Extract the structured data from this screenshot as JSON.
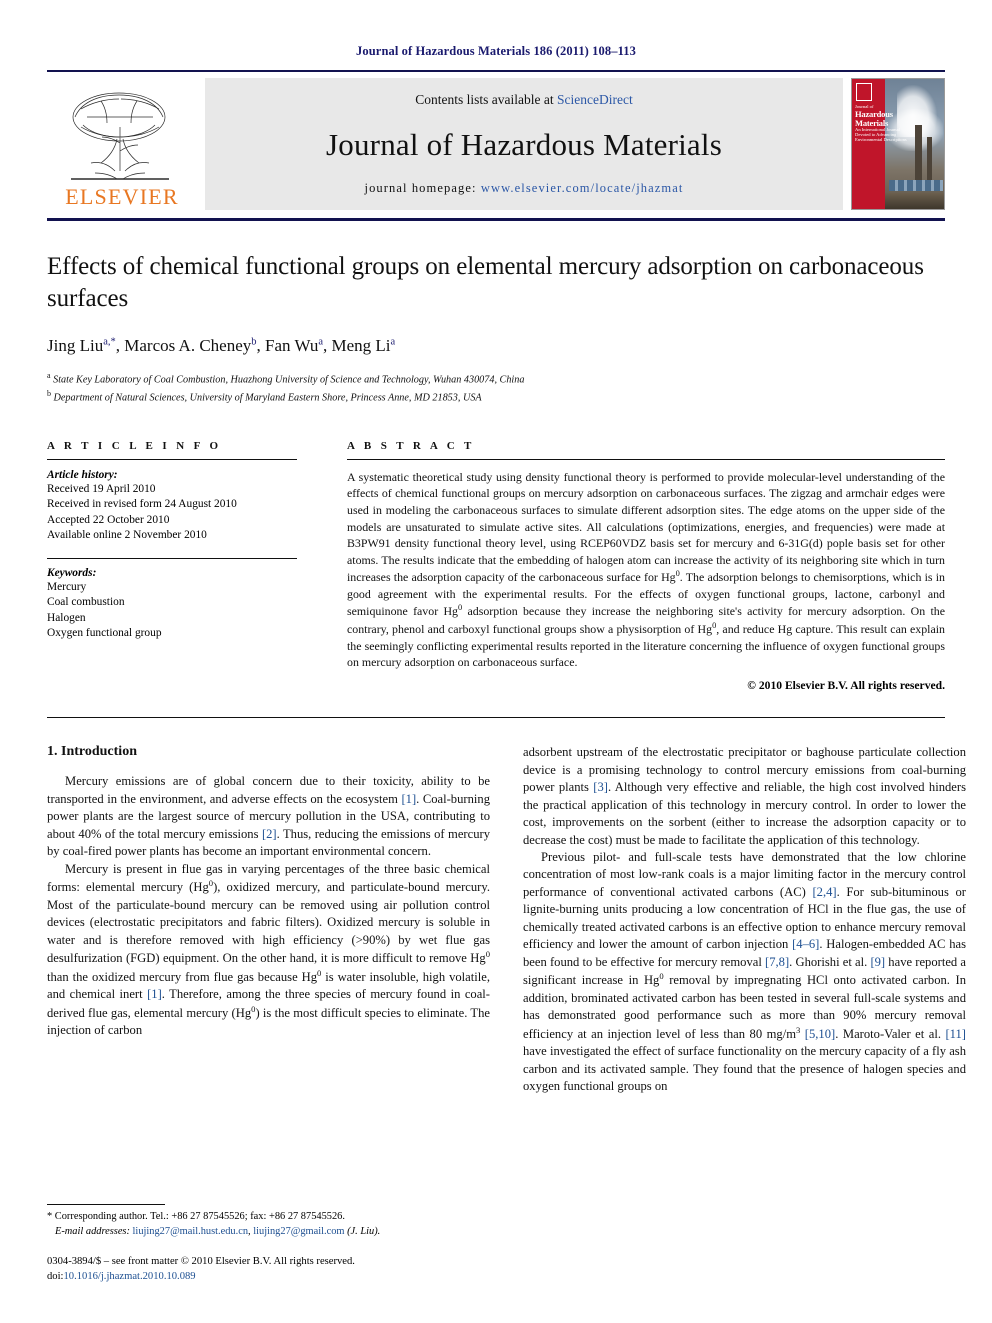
{
  "running_head": "Journal of Hazardous Materials 186 (2011) 108–113",
  "masthead": {
    "publisher": "ELSEVIER",
    "contents_prefix": "Contents lists available at",
    "sciencedirect": "ScienceDirect",
    "journal_name": "Journal of Hazardous Materials",
    "homepage_label": "journal homepage:",
    "homepage_url": "www.elsevier.com/locate/jhazmat",
    "cover": {
      "journal_of": "Journal of",
      "line1": "Hazardous",
      "line2": "Materials",
      "sub1": "An International Journal Devoted to Advancing",
      "sub2": "Environmental Descriptions"
    },
    "colors": {
      "link": "#2b57a6",
      "elsevier_orange": "#E87722",
      "cover_red": "#c0152a",
      "band_gray": "#e8e8e8",
      "rule_navy": "#12124f"
    }
  },
  "title": "Effects of chemical functional groups on elemental mercury adsorption on carbonaceous surfaces",
  "authors_html": "Jing Liu, Marcos A. Cheney, Fan Wu, Meng Li",
  "authors": [
    {
      "name": "Jing Liu",
      "marks": "a,*"
    },
    {
      "name": "Marcos A. Cheney",
      "marks": "b"
    },
    {
      "name": "Fan Wu",
      "marks": "a"
    },
    {
      "name": "Meng Li",
      "marks": "a"
    }
  ],
  "affiliations": [
    {
      "mark": "a",
      "text": "State Key Laboratory of Coal Combustion, Huazhong University of Science and Technology, Wuhan 430074, China"
    },
    {
      "mark": "b",
      "text": "Department of Natural Sciences, University of Maryland Eastern Shore, Princess Anne, MD 21853, USA"
    }
  ],
  "article_info": {
    "heading": "A R T I C L E   I N F O",
    "history_title": "Article history:",
    "history": [
      "Received 19 April 2010",
      "Received in revised form 24 August 2010",
      "Accepted 22 October 2010",
      "Available online 2 November 2010"
    ],
    "keywords_title": "Keywords:",
    "keywords": [
      "Mercury",
      "Coal combustion",
      "Halogen",
      "Oxygen functional group"
    ]
  },
  "abstract": {
    "heading": "A B S T R A C T",
    "part1": "A systematic theoretical study using density functional theory is performed to provide molecular-level understanding of the effects of chemical functional groups on mercury adsorption on carbonaceous surfaces. The zigzag and armchair edges were used in modeling the carbonaceous surfaces to simulate different adsorption sites. The edge atoms on the upper side of the models are unsaturated to simulate active sites. All calculations (optimizations, energies, and frequencies) were made at B3PW91 density functional theory level, using RCEP60VDZ basis set for mercury and 6-31G(d) pople basis set for other atoms. The results indicate that the embedding of halogen atom can increase the activity of its neighboring site which in turn increases the adsorption capacity of the carbonaceous surface for Hg",
    "sup1": "0",
    "part2": ". The adsorption belongs to chemisorptions, which is in good agreement with the experimental results. For the effects of oxygen functional groups, lactone, carbonyl and semiquinone favor Hg",
    "sup2": "0",
    "part3": " adsorption because they increase the neighboring site's activity for mercury adsorption. On the contrary, phenol and carboxyl functional groups show a physisorption of Hg",
    "sup3": "0",
    "part4": ", and reduce Hg capture. This result can explain the seemingly conflicting experimental results reported in the literature concerning the influence of oxygen functional groups on mercury adsorption on carbonaceous surface.",
    "copyright": "© 2010 Elsevier B.V. All rights reserved."
  },
  "section": {
    "number_title": "1. Introduction"
  },
  "body": {
    "left_p1_a": "Mercury emissions are of global concern due to their toxicity, ability to be transported in the environment, and adverse effects on the ecosystem ",
    "left_p1_c1": "[1]",
    "left_p1_b": ". Coal-burning power plants are the largest source of mercury pollution in the USA, contributing to about 40% of the total mercury emissions ",
    "left_p1_c2": "[2]",
    "left_p1_c": ". Thus, reducing the emissions of mercury by coal-fired power plants has become an important environmental concern.",
    "left_p2_a": "Mercury is present in flue gas in varying percentages of the three basic chemical forms: elemental mercury (Hg",
    "left_p2_sup1": "0",
    "left_p2_b": "), oxidized mercury, and particulate-bound mercury. Most of the particulate-bound mercury can be removed using air pollution control devices (electrostatic precipitators and fabric filters). Oxidized mercury is soluble in water and is therefore removed with high efficiency (>90%) by wet flue gas desulfurization (FGD) equipment. On the other hand, it is more difficult to remove Hg",
    "left_p2_sup2": "0",
    "left_p2_c": " than the oxidized mercury from flue gas because Hg",
    "left_p2_sup3": "0",
    "left_p2_d": " is water insoluble, high volatile, and chemical inert ",
    "left_p2_c3": "[1]",
    "left_p2_e": ". Therefore, among the three species of mercury found in coal-derived flue gas, elemental mercury (Hg",
    "left_p2_sup4": "0",
    "left_p2_f": ") is the most difficult species to eliminate. The injection of carbon",
    "right_p1_a": "adsorbent upstream of the electrostatic precipitator or baghouse particulate collection device is a promising technology to control mercury emissions from coal-burning power plants ",
    "right_p1_c1": "[3]",
    "right_p1_b": ". Although very effective and reliable, the high cost involved hinders the practical application of this technology in mercury control. In order to lower the cost, improvements on the sorbent (either to increase the adsorption capacity or to decrease the cost) must be made to facilitate the application of this technology.",
    "right_p2_a": "Previous pilot- and full-scale tests have demonstrated that the low chlorine concentration of most low-rank coals is a major limiting factor in the mercury control performance of conventional activated carbons (AC) ",
    "right_p2_c1": "[2,4]",
    "right_p2_b": ". For sub-bituminous or lignite-burning units producing a low concentration of HCl in the flue gas, the use of chemically treated activated carbons is an effective option to enhance mercury removal efficiency and lower the amount of carbon injection ",
    "right_p2_c2": "[4–6]",
    "right_p2_c": ". Halogen-embedded AC has been found to be effective for mercury removal ",
    "right_p2_c3": "[7,8]",
    "right_p2_d": ". Ghorishi et al. ",
    "right_p2_c4": "[9]",
    "right_p2_e": " have reported a significant increase in Hg",
    "right_p2_sup1": "0",
    "right_p2_f": " removal by impregnating HCl onto activated carbon. In addition, brominated activated carbon has been tested in several full-scale systems and has demonstrated good performance such as more than 90% mercury removal efficiency at an injection level of less than 80 mg/m",
    "right_p2_sup2": "3",
    "right_p2_g": " ",
    "right_p2_c5": "[5,10]",
    "right_p2_h": ". Maroto-Valer et al. ",
    "right_p2_c6": "[11]",
    "right_p2_i": " have investigated the effect of surface functionality on the mercury capacity of a fly ash carbon and its activated sample. They found that the presence of halogen species and oxygen functional groups on"
  },
  "footnotes": {
    "corresponding": "* Corresponding author. Tel.: +86 27 87545526; fax: +86 27 87545526.",
    "email_label": "E-mail addresses:",
    "email1": "liujing27@mail.hust.edu.cn",
    "email_sep": ", ",
    "email2": "liujing27@gmail.com",
    "email_suffix": " (J. Liu).",
    "issn_line": "0304-3894/$ – see front matter © 2010 Elsevier B.V. All rights reserved.",
    "doi_label": "doi:",
    "doi_value": "10.1016/j.jhazmat.2010.10.089"
  }
}
